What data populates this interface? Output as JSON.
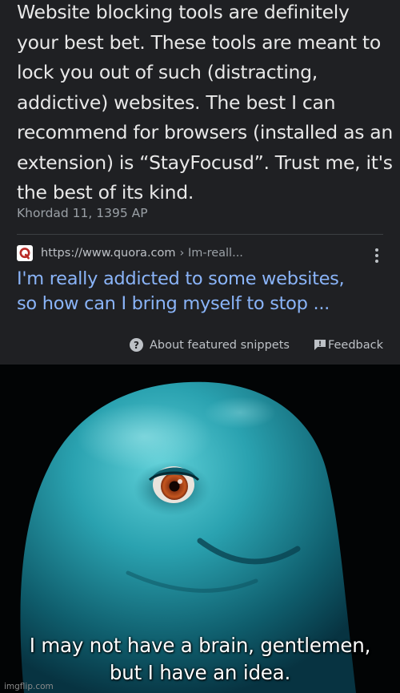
{
  "snippet": {
    "text": "Website blocking tools are definitely your best bet. These tools are meant to lock you out of such (distracting, addictive) websites. The best I can recommend for browsers (installed as an extension) is “StayFocusd”. Trust me, it's the best of its kind.",
    "date": "Khordad 11, 1395 AP"
  },
  "source": {
    "favicon": "quora-icon",
    "url": "https://www.quora.com",
    "breadcrumb": "› Im-reall...",
    "title_line1": "I'm really addicted to some websites,",
    "title_line2": "so how can I bring myself to stop ..."
  },
  "footer": {
    "help_icon_glyph": "?",
    "about_label": "About featured snippets",
    "feedback_label": "Feedback"
  },
  "meme": {
    "caption_line1": "I may not have a brain, gentlemen,",
    "caption_line2": "but I have an idea.",
    "watermark": "imgflip.com"
  },
  "colors": {
    "card_bg": "#1f2023",
    "link_blue": "#8ab4f8",
    "text": "#e8e8e8",
    "muted": "#9aa0a6",
    "quora_red": "#b92b27"
  }
}
